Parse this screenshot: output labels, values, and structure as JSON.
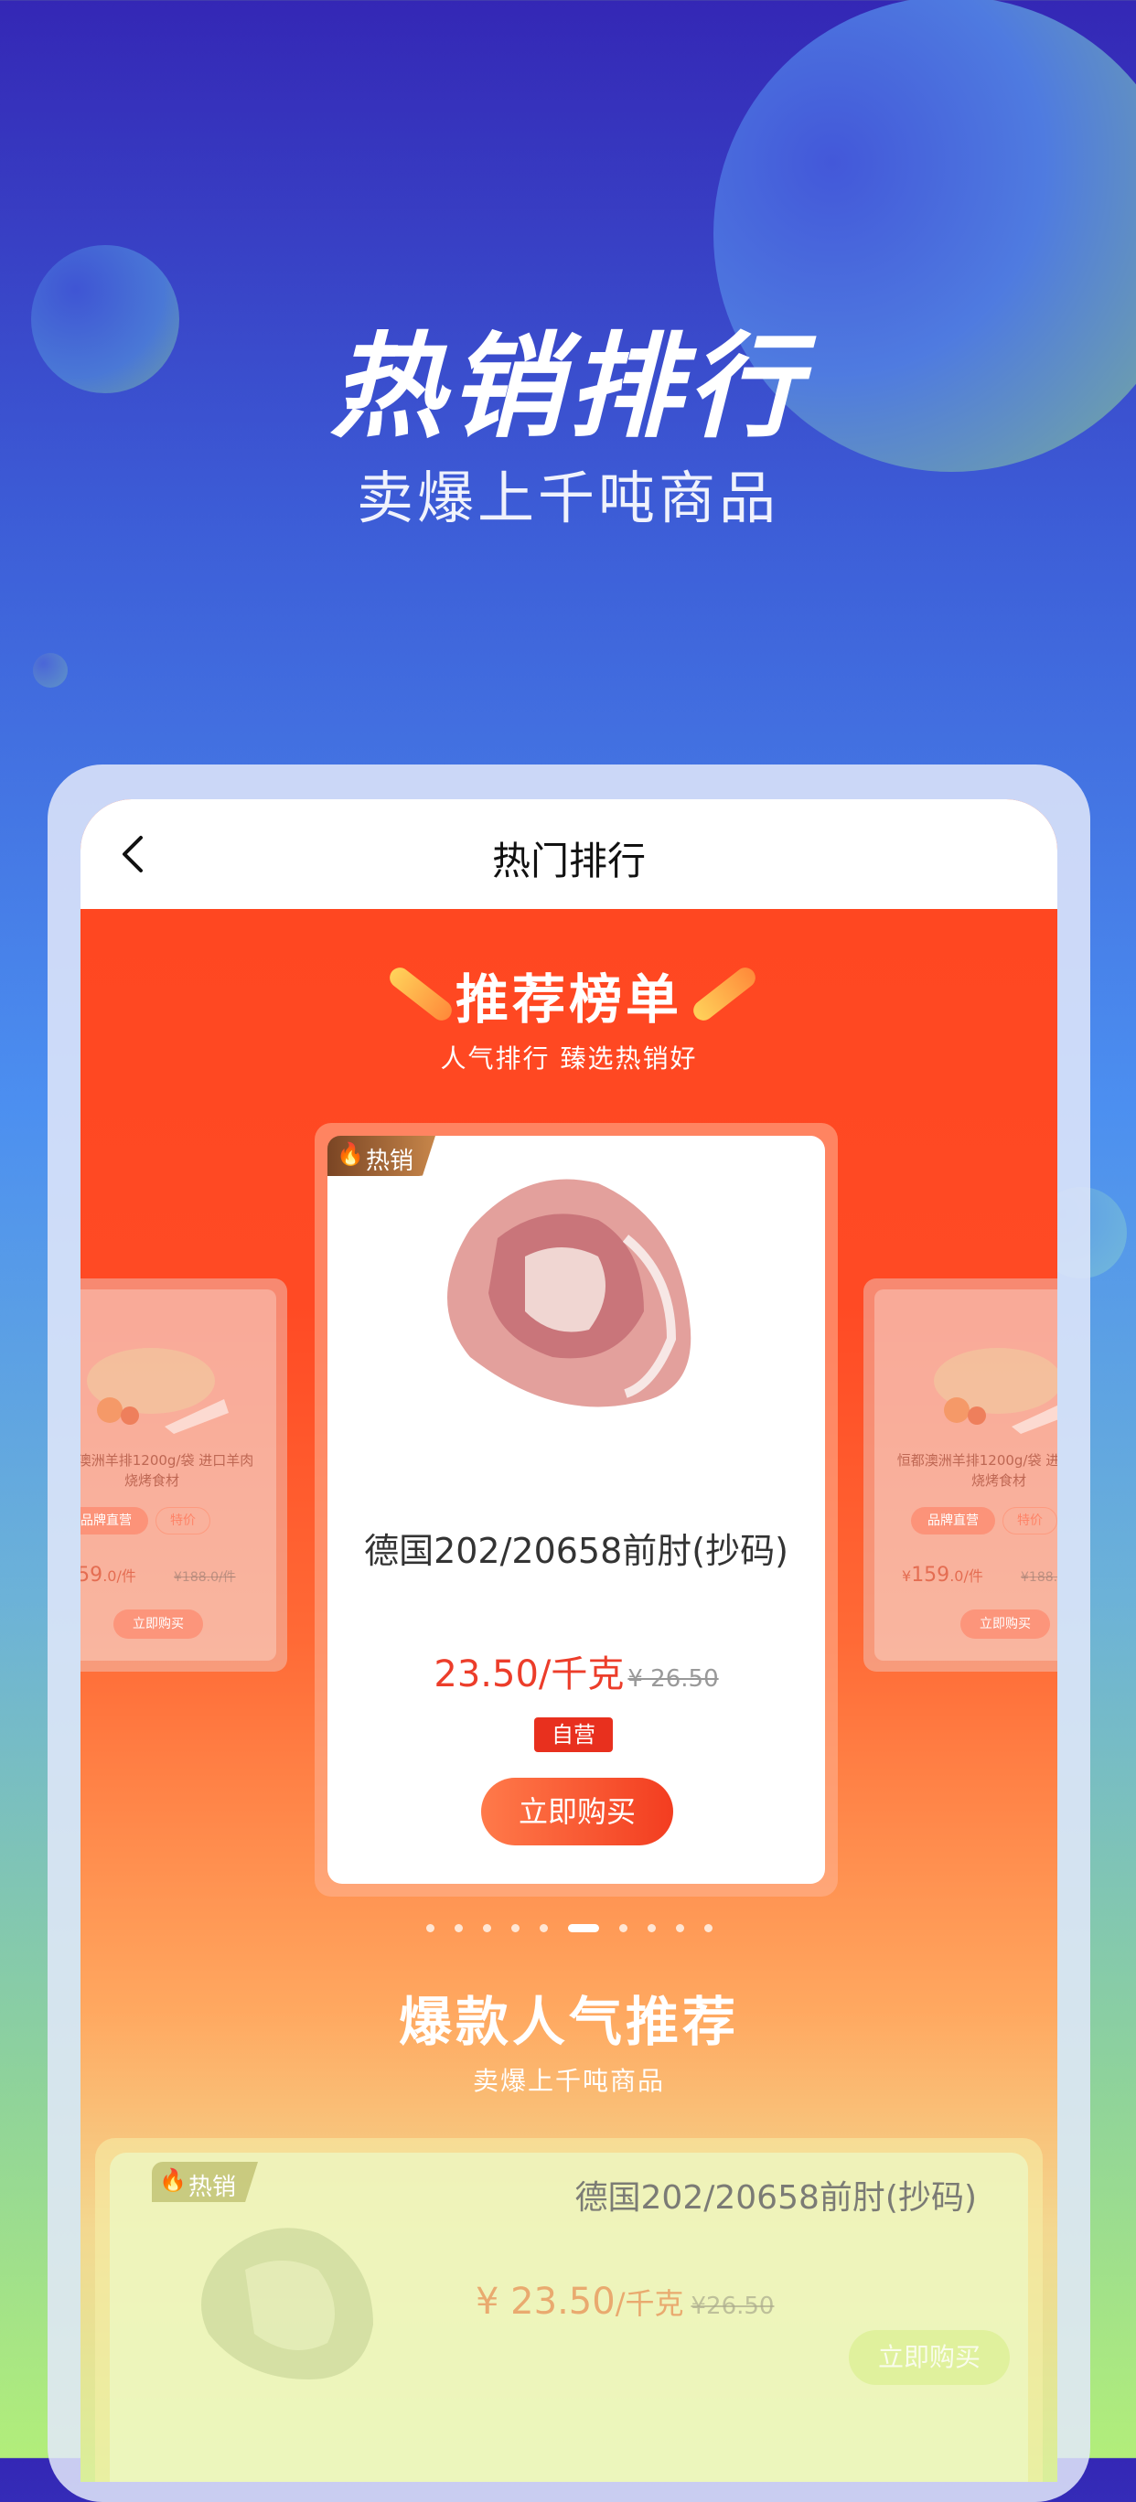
{
  "hero": {
    "title": "热销排行",
    "subtitle": "卖爆上千吨商品"
  },
  "nav": {
    "title": "热门排行",
    "back_icon": "chevron-left-icon"
  },
  "recommend": {
    "title": "推荐榜单",
    "subtitle": "人气排行 臻选热销好"
  },
  "main_product": {
    "tag": "热销",
    "tag_icon": "fire-icon",
    "name": "德国202/20658前肘(抄码)",
    "price": "23.50/千克",
    "old_price": "¥ 26.50",
    "self_label": "自营",
    "buy_label": "立即购买"
  },
  "side_product": {
    "name": "恒都澳洲羊排1200g/袋 进口羊肉 烧烤食材",
    "badge1": "品牌直营",
    "badge2": "特价",
    "price_symbol": "¥",
    "price": "159",
    "price_unit": ".0/件",
    "old_price": "¥188.0/件",
    "buy_label": "立即购买"
  },
  "carousel": {
    "count": 11,
    "active_index": 5
  },
  "popular": {
    "title": "爆款人气推荐",
    "subtitle": "卖爆上千吨商品"
  },
  "bottom_product": {
    "tag": "热销",
    "name": "德国202/20658前肘(抄码)",
    "price": "¥ 23.50",
    "unit": "/千克",
    "old_price": "¥26.50",
    "buy_label": "立即购买"
  },
  "colors": {
    "accent": "#ff4620",
    "price": "#ec3d2a",
    "button": "#f33d20"
  }
}
